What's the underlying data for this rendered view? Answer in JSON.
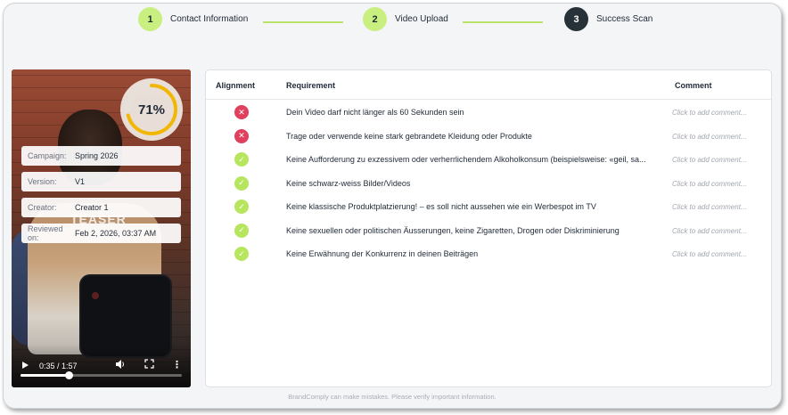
{
  "stepper": {
    "steps": [
      {
        "number": "1",
        "label": "Contact Information",
        "state": "done"
      },
      {
        "number": "2",
        "label": "Video Upload",
        "state": "done"
      },
      {
        "number": "3",
        "label": "Success Scan",
        "state": "active"
      }
    ]
  },
  "video": {
    "score_label": "71%",
    "score_value": 0.71,
    "overlay_text": "TEASER",
    "meta": [
      {
        "label": "Campaign:",
        "value": "Spring 2026"
      },
      {
        "label": "Version:",
        "value": "V1"
      },
      {
        "label": "Creator:",
        "value": "Creator 1"
      },
      {
        "label": "Reviewed on:",
        "value": "Feb 2, 2026, 03:37 AM"
      }
    ],
    "time": "0:35 / 1:57",
    "progress": 0.3
  },
  "table": {
    "headers": {
      "alignment": "Alignment",
      "requirement": "Requirement",
      "comment": "Comment"
    },
    "rows": [
      {
        "status": "fail",
        "requirement": "Dein Video darf nicht länger als 60 Sekunden sein",
        "comment": "Click to add comment..."
      },
      {
        "status": "fail",
        "requirement": "Trage oder verwende keine stark gebrandete Kleidung oder Produkte",
        "comment": "Click to add comment..."
      },
      {
        "status": "pass",
        "requirement": "Keine Aufforderung zu exzessivem oder verherrlichendem Alkoholkonsum (beispielsweise: «geil, sa...",
        "comment": "Click to add comment..."
      },
      {
        "status": "pass",
        "requirement": "Keine schwarz-weiss Bilder/Videos",
        "comment": "Click to add comment..."
      },
      {
        "status": "pass",
        "requirement": "Keine klassische Produktplatzierung! – es soll nicht aussehen wie ein Werbespot im TV",
        "comment": "Click to add comment..."
      },
      {
        "status": "pass",
        "requirement": "Keine sexuellen oder politischen Äusserungen, keine Zigaretten, Drogen oder Diskriminierung",
        "comment": "Click to add comment..."
      },
      {
        "status": "pass",
        "requirement": "Keine Erwähnung der Konkurrenz in deinen Beiträgen",
        "comment": "Click to add comment..."
      }
    ]
  },
  "icons": {
    "fail": "x-icon",
    "pass": "check-icon",
    "play": "play-icon",
    "volume": "volume-icon",
    "fullscreen": "fullscreen-icon",
    "more": "more-vertical-icon"
  },
  "colors": {
    "accent_green": "#c8ef7f",
    "pass": "#b8e55e",
    "fail": "#e0405e",
    "active_step": "#263238",
    "score_ring": "#f2b705"
  },
  "footer": "BrandComply can make mistakes. Please verify important information."
}
